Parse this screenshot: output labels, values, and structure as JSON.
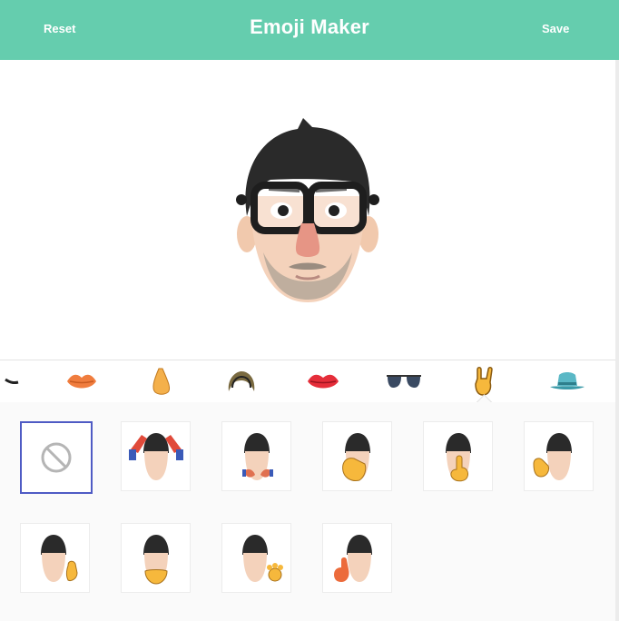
{
  "app": {
    "title": "Emoji Maker",
    "reset_label": "Reset",
    "save_label": "Save",
    "accent_color": "#65cdae",
    "selection_color": "#4f5bc4"
  },
  "categories": [
    {
      "name": "brows",
      "icon": "eyebrow-icon"
    },
    {
      "name": "mouth",
      "icon": "lips-icon"
    },
    {
      "name": "nose",
      "icon": "nose-icon"
    },
    {
      "name": "hair",
      "icon": "hair-icon"
    },
    {
      "name": "lipstick",
      "icon": "red-lips-icon"
    },
    {
      "name": "glasses",
      "icon": "sunglasses-icon"
    },
    {
      "name": "hands",
      "icon": "rock-hand-icon",
      "active": true
    },
    {
      "name": "hats",
      "icon": "fedora-hat-icon"
    }
  ],
  "hand_options": [
    {
      "name": "none",
      "icon": "prohibited-icon",
      "selected": true
    },
    {
      "name": "hands-on-head",
      "icon": "hands-on-head-icon"
    },
    {
      "name": "finger-guns",
      "icon": "finger-guns-icon"
    },
    {
      "name": "facepalm",
      "icon": "facepalm-icon"
    },
    {
      "name": "shush-finger",
      "icon": "shush-finger-icon"
    },
    {
      "name": "ok-hand",
      "icon": "ok-hand-icon"
    },
    {
      "name": "hand-on-cheek",
      "icon": "hand-on-cheek-icon"
    },
    {
      "name": "chin-hand",
      "icon": "chin-hand-icon"
    },
    {
      "name": "wave-paw",
      "icon": "paw-hand-icon"
    },
    {
      "name": "thumbs-up",
      "icon": "thumbs-up-icon"
    }
  ]
}
